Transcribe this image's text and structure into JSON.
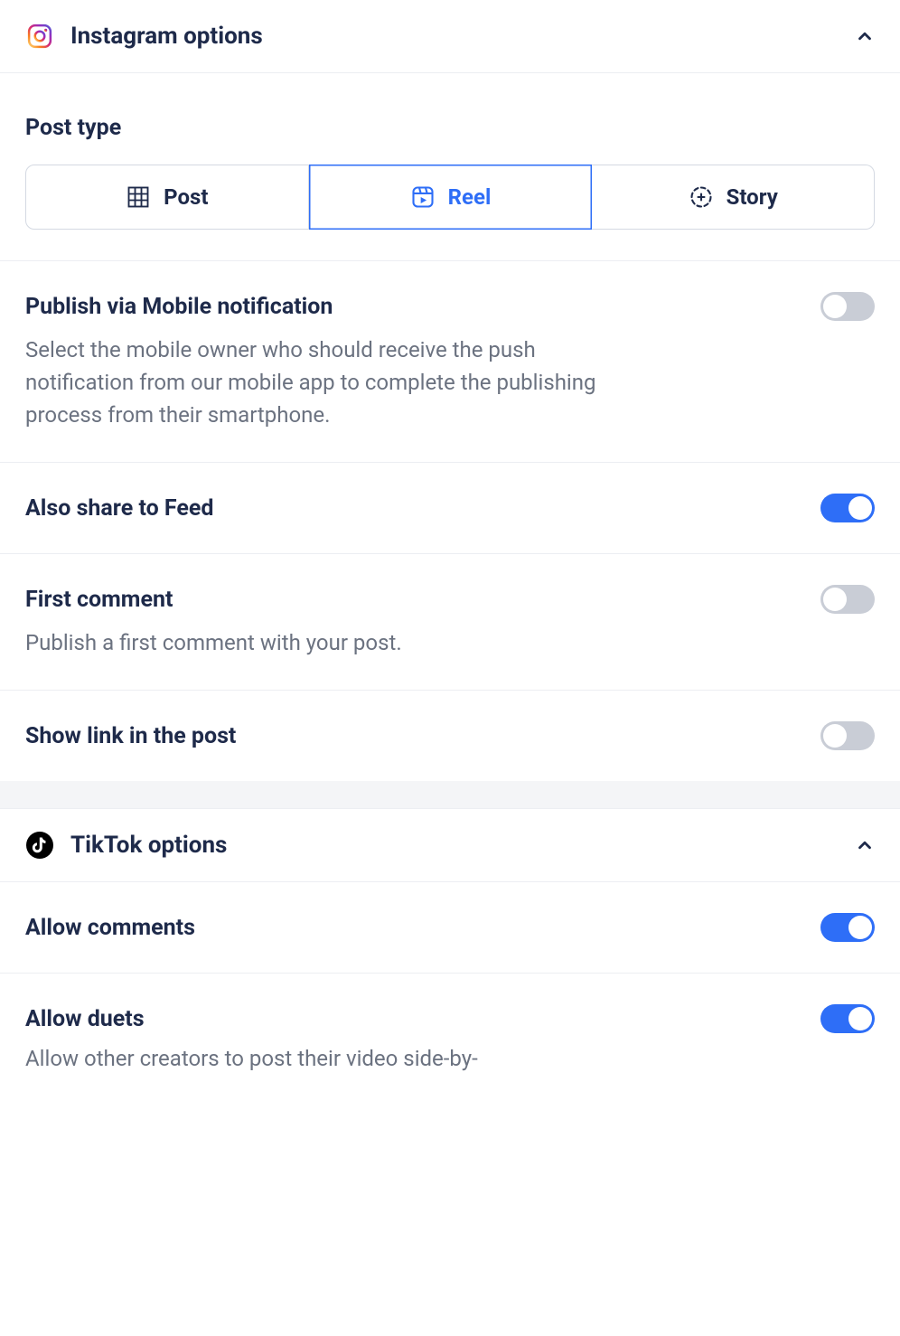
{
  "instagram": {
    "section_title": "Instagram options",
    "expanded": true,
    "post_type": {
      "heading": "Post type",
      "options": {
        "post": {
          "label": "Post",
          "selected": false
        },
        "reel": {
          "label": "Reel",
          "selected": true
        },
        "story": {
          "label": "Story",
          "selected": false
        }
      }
    },
    "publish_mobile": {
      "heading": "Publish via Mobile notification",
      "description": "Select the mobile owner who should receive the push notification from our mobile app to complete the publishing process from their smartphone.",
      "enabled": false
    },
    "share_feed": {
      "heading": "Also share to Feed",
      "enabled": true
    },
    "first_comment": {
      "heading": "First comment",
      "description": "Publish a first comment with your post.",
      "enabled": false
    },
    "show_link": {
      "heading": "Show link in the post",
      "enabled": false
    }
  },
  "tiktok": {
    "section_title": "TikTok options",
    "expanded": true,
    "allow_comments": {
      "heading": "Allow comments",
      "enabled": true
    },
    "allow_duets": {
      "heading": "Allow duets",
      "description": "Allow other creators to post their video side-by-",
      "enabled": true
    }
  }
}
